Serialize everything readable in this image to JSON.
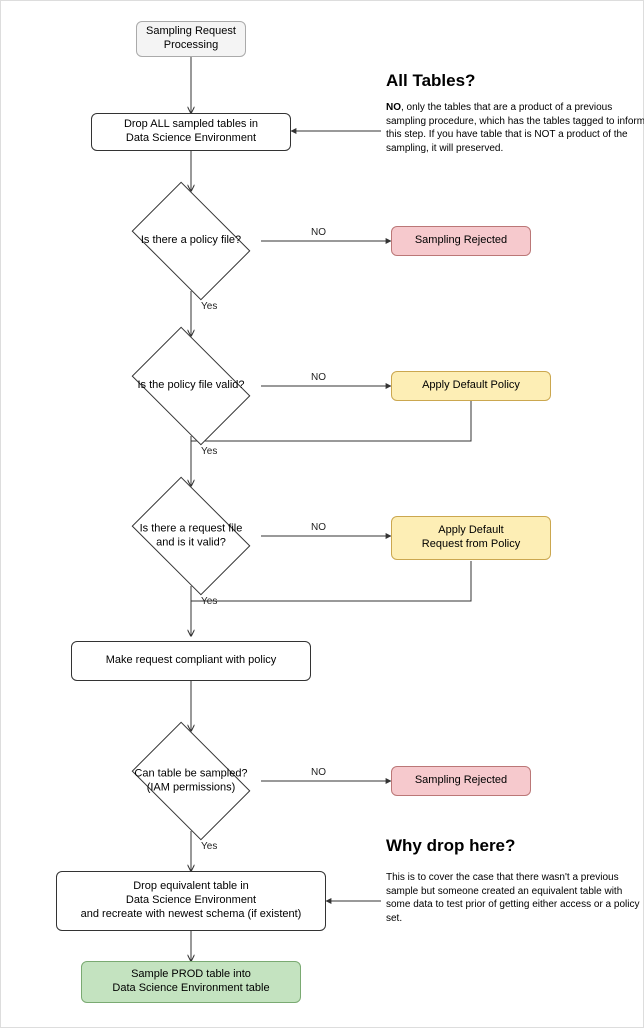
{
  "nodes": {
    "start": "Sampling Request\nProcessing",
    "drop_all": "Drop ALL sampled tables in\nData Science Environment",
    "policy_file": "Is there a policy file?",
    "rejected1": "Sampling Rejected",
    "policy_valid": "Is the policy file valid?",
    "apply_default": "Apply Default Policy",
    "request_file": "Is there a request file\nand is it valid?",
    "apply_request": "Apply Default\nRequest from Policy",
    "compliant": "Make request compliant with policy",
    "can_sample": "Can table be sampled?\n(IAM permissions)",
    "rejected2": "Sampling Rejected",
    "drop_equiv": "Drop equivalent table in\nData Science Environment\nand recreate with newest schema (if existent)",
    "sample_prod": "Sample PROD table into\nData Science Environment table"
  },
  "labels": {
    "no": "NO",
    "yes": "Yes"
  },
  "callouts": {
    "top_title": "All Tables?",
    "top_body_bold": "NO",
    "top_body": ", only the tables that are a product of a previous sampling procedure, which has the tables tagged to inform this step. If you have table that is NOT a product of the sampling, it will preserved.",
    "bottom_title": "Why drop here?",
    "bottom_body": "This is to cover the case that there wasn't a previous sample but someone created an equivalent table with some data to test prior of getting either access or a policy set."
  }
}
